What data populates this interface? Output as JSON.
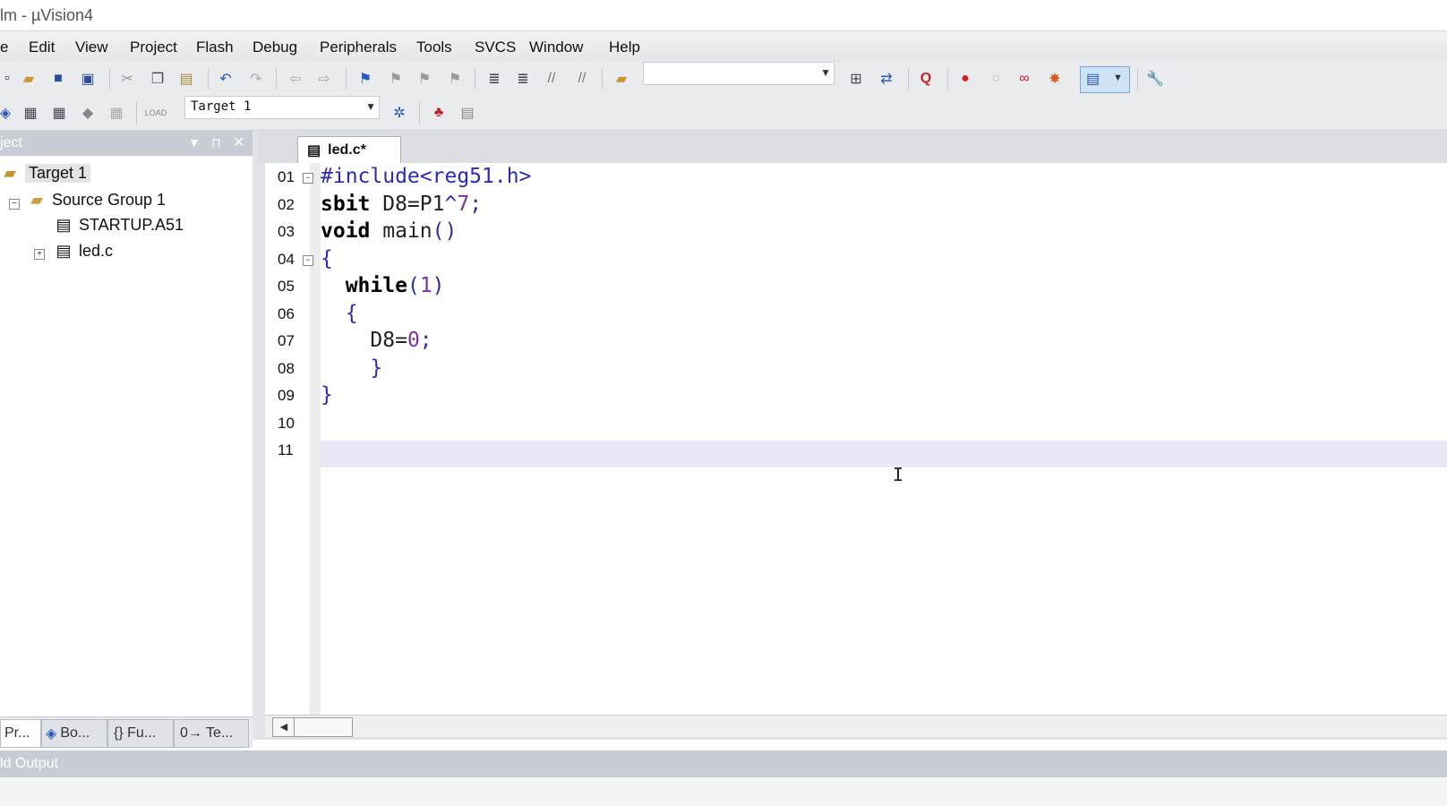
{
  "window": {
    "title": "lm  - µVision4"
  },
  "menu": [
    "e",
    "Edit",
    "View",
    "Project",
    "Flash",
    "Debug",
    "Peripherals",
    "Tools",
    "SVCS",
    "Window",
    "Help"
  ],
  "toolbar": {
    "target_select": "Target 1"
  },
  "project_panel": {
    "title": "ject",
    "tree": {
      "target": "Target 1",
      "group": "Source Group 1",
      "files": [
        "STARTUP.A51",
        "led.c"
      ]
    },
    "tabs": [
      "Pr...",
      "Bo...",
      "{} Fu...",
      "0→ Te..."
    ]
  },
  "editor": {
    "tab_label": "led.c*",
    "line_numbers": [
      "01",
      "02",
      "03",
      "04",
      "05",
      "06",
      "07",
      "08",
      "09",
      "10",
      "11"
    ],
    "lines": [
      {
        "parts": [
          {
            "t": "#include<reg51.h>",
            "c": "pp"
          }
        ]
      },
      {
        "parts": [
          {
            "t": "sbit",
            "c": "kw"
          },
          {
            "t": " D8=P1",
            "c": ""
          },
          {
            "t": "^",
            "c": "br"
          },
          {
            "t": "7",
            "c": "num"
          },
          {
            "t": ";",
            "c": "br"
          }
        ]
      },
      {
        "parts": [
          {
            "t": "void",
            "c": "kw"
          },
          {
            "t": " main",
            "c": ""
          },
          {
            "t": "()",
            "c": "br"
          }
        ]
      },
      {
        "parts": [
          {
            "t": "{",
            "c": "br"
          }
        ]
      },
      {
        "parts": [
          {
            "t": "  ",
            "c": ""
          },
          {
            "t": "while",
            "c": "kw"
          },
          {
            "t": "(",
            "c": "br"
          },
          {
            "t": "1",
            "c": "num"
          },
          {
            "t": ")",
            "c": "br"
          }
        ]
      },
      {
        "parts": [
          {
            "t": "  {",
            "c": "br"
          }
        ]
      },
      {
        "parts": [
          {
            "t": "    D8=",
            "c": ""
          },
          {
            "t": "0",
            "c": "num"
          },
          {
            "t": ";",
            "c": "br"
          }
        ]
      },
      {
        "parts": [
          {
            "t": "    }",
            "c": "br"
          }
        ]
      },
      {
        "parts": [
          {
            "t": "}",
            "c": "br"
          }
        ]
      },
      {
        "parts": []
      },
      {
        "parts": []
      }
    ]
  },
  "build_output": {
    "title": "ld Output"
  }
}
